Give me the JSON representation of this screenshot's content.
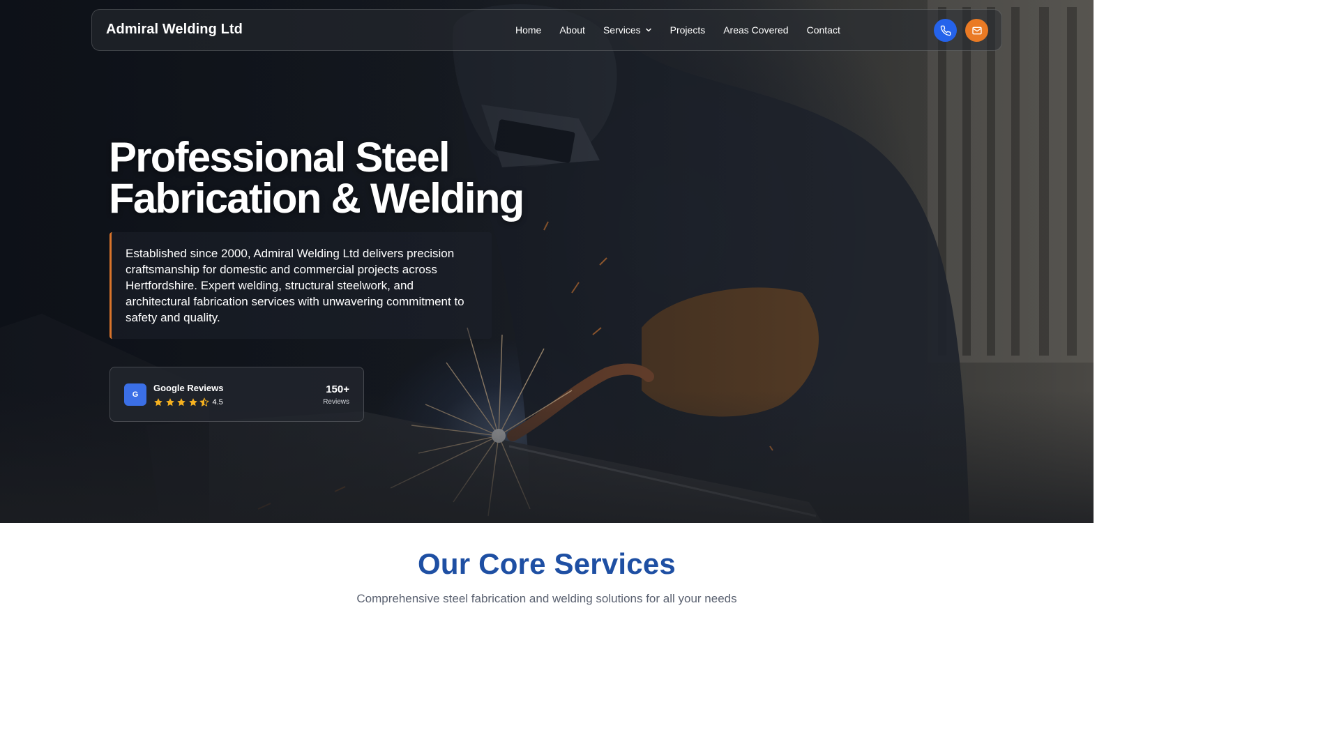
{
  "brand": {
    "name": "Admiral Welding Ltd"
  },
  "nav": {
    "items": [
      {
        "label": "Home"
      },
      {
        "label": "About"
      },
      {
        "label": "Services",
        "icon": "chevron-down-icon"
      },
      {
        "label": "Projects"
      },
      {
        "label": "Areas Covered"
      },
      {
        "label": "Contact"
      }
    ],
    "actions": [
      {
        "icon": "phone-icon",
        "color": "#2563eb"
      },
      {
        "icon": "mail-icon",
        "color": "#ea7a24"
      }
    ]
  },
  "hero": {
    "title_line1": "Professional Steel",
    "title_line2": "Fabrication & Welding",
    "intro": "Established since 2000, Admiral Welding Ltd delivers precision craftsmanship for domestic and commercial projects across Hertfordshire. Expert welding, structural steelwork, and architectural fabrication services with unwavering commitment to safety and quality.",
    "accent_color": "#d9742b",
    "background_image": "welder-at-work-photo"
  },
  "reviews": {
    "badge_letter": "G",
    "label": "Google Reviews",
    "rating": "4.5",
    "rating_value": 4.5,
    "rating_max": 5,
    "count": "150+",
    "count_label": "Reviews",
    "star_color": "#f5b120"
  },
  "services": {
    "title": "Our Core Services",
    "subtitle": "Comprehensive steel fabrication and welding solutions for all your needs",
    "title_color": "#1e4fa3"
  }
}
